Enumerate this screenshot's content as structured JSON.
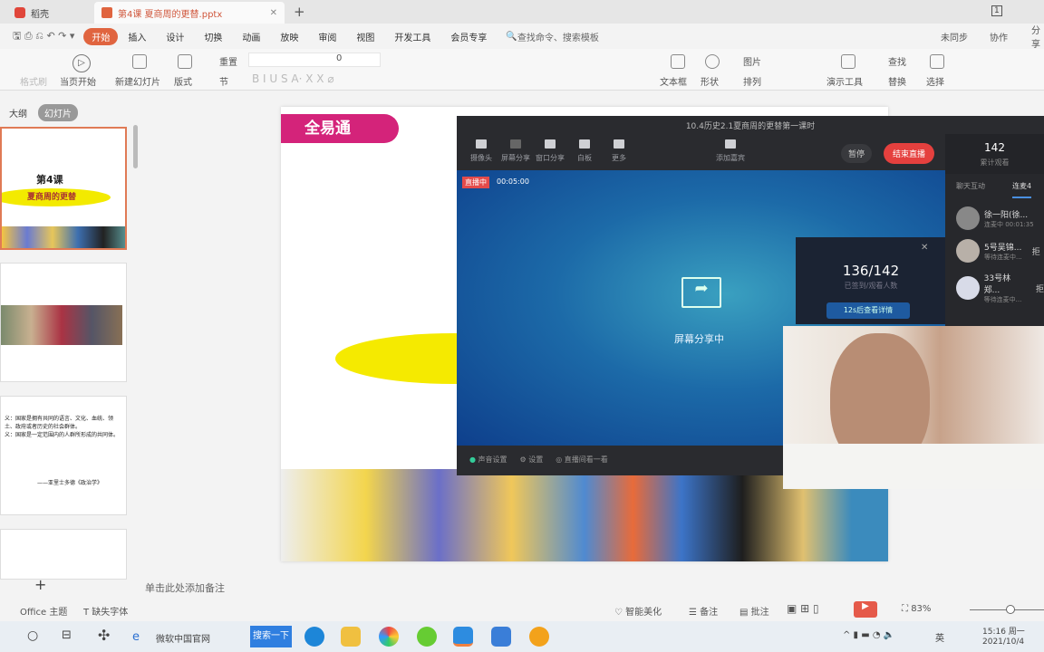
{
  "tabs": [
    {
      "label": "稻壳",
      "icon": "docer-logo-icon"
    },
    {
      "label": "第4课 夏商周的更替.pptx",
      "icon": "ppt-file-icon",
      "active": true
    }
  ],
  "menu": {
    "items": [
      "开始",
      "插入",
      "设计",
      "切换",
      "动画",
      "放映",
      "审阅",
      "视图",
      "开发工具",
      "会员专享"
    ],
    "active": "开始",
    "search_placeholder": "查找命令、搜索模板",
    "sync": "未同步",
    "collab": "协作",
    "share": "分享"
  },
  "ribbon": {
    "format_painter": "格式刷",
    "play_from_current": "当页开始",
    "new_slide": "新建幻灯片",
    "layout": "版式",
    "reset": "重置",
    "section": "节",
    "font_size": "0",
    "textbox": "文本框",
    "shape": "形状",
    "picture": "图片",
    "arrange": "排列",
    "present_tools": "演示工具",
    "find": "查找",
    "replace": "替换",
    "select": "选择"
  },
  "leftpane": {
    "tab_outline": "大纲",
    "tab_slides": "幻灯片",
    "slide1_title": "第4课",
    "slide1_subtitle": "夏商周的更替",
    "slide3_quote": "——亚里士多德《政治学》"
  },
  "slide": {
    "logo": "全易通"
  },
  "notes_placeholder": "单击此处添加备注",
  "live": {
    "title": "10.4历史2.1夏商周的更替第一课时",
    "tools": [
      "摄像头",
      "屏幕分享",
      "窗口分享",
      "白板",
      "更多"
    ],
    "add_guest": "添加嘉宾",
    "pause": "暂停",
    "end": "结束直播",
    "viewers": "142",
    "viewers_label": "累计观看",
    "badge": "直播中",
    "elapsed": "00:05:00",
    "sharing": "屏幕分享中",
    "popup": {
      "count": "136/142",
      "label": "已签到/观看人数",
      "button": "12s后查看详情"
    },
    "side_tabs": [
      "聊天互动",
      "连麦4"
    ],
    "contacts": [
      {
        "name": "徐一阳(徐...",
        "status": "连麦中 00:01:35"
      },
      {
        "name": "5号吴锦...",
        "status": "等待连麦中..."
      },
      {
        "name": "33号林郑...",
        "status": "等待连麦中..."
      }
    ],
    "reject": "拒",
    "bottom": [
      "声音设置",
      "设置",
      "直播间看一看"
    ]
  },
  "status": {
    "theme": "Office 主题",
    "missing_font": "缺失字体",
    "beautify": "智能美化",
    "notes": "备注",
    "comments": "批注",
    "zoom": "83%"
  },
  "taskbar": {
    "browser_tab": "微软中国官网",
    "search_btn": "搜索一下",
    "ime": "英",
    "time": "15:16 周一",
    "date": "2021/10/4"
  },
  "colors": {
    "accent": "#e0643f",
    "end_live": "#e5403e",
    "live_bg": "#2a2b2f"
  }
}
